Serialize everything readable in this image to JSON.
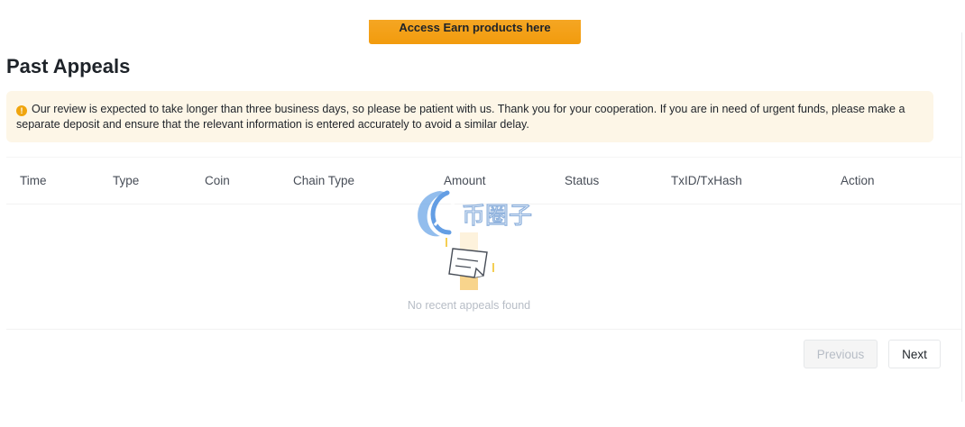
{
  "promo": {
    "label": "Access Earn products here"
  },
  "page": {
    "title": "Past Appeals"
  },
  "notice": {
    "icon": "warning-icon",
    "text": "Our review is expected to take longer than three business days, so please be patient with us. Thank you for your cooperation. If you are in need of urgent funds, please make a separate deposit and ensure that the relevant information is entered accurately to avoid a similar delay."
  },
  "table": {
    "columns": [
      "Time",
      "Type",
      "Coin",
      "Chain Type",
      "Amount",
      "Status",
      "TxID/TxHash",
      "Action"
    ],
    "empty_text": "No recent appeals found"
  },
  "pagination": {
    "previous_label": "Previous",
    "next_label": "Next"
  },
  "watermark": {
    "text": "币圈子"
  },
  "colors": {
    "accent": "#F0B90B",
    "banner": "#F29B0D",
    "notice_bg": "#FDF6E7",
    "warning": "#F0A50E"
  }
}
